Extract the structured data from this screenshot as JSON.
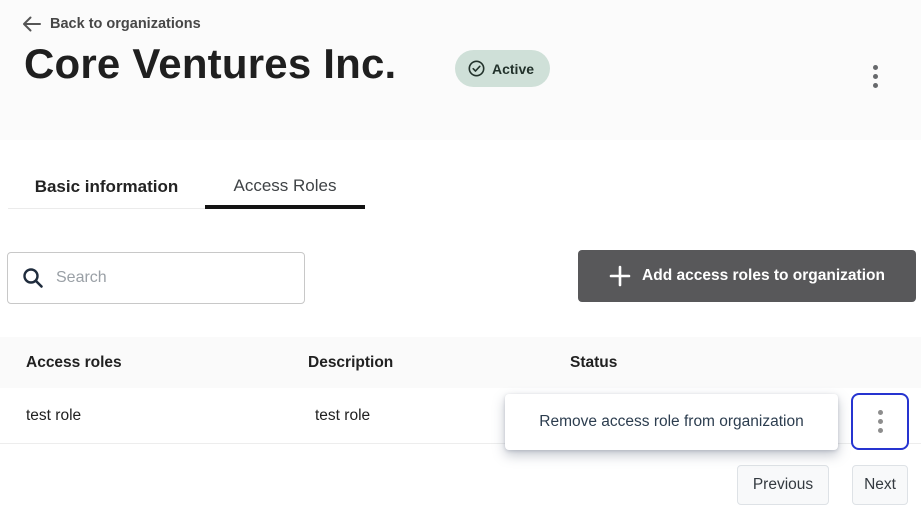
{
  "header": {
    "back_label": "Back to organizations",
    "title": "Core Ventures Inc.",
    "status_badge": "Active",
    "icons": {
      "back": "left-arrow-icon",
      "status": "check-circle-icon",
      "menu": "vertical-ellipsis-icon"
    }
  },
  "tabs": [
    {
      "label": "Basic information",
      "active": false
    },
    {
      "label": "Access Roles",
      "active": true
    }
  ],
  "toolbar": {
    "search_placeholder": "Search",
    "search_value": "",
    "search_icon": "magnifier-icon",
    "add_button_label": "Add access roles to organization",
    "add_button_icon": "plus-icon"
  },
  "table": {
    "columns": [
      "Access roles",
      "Description",
      "Status"
    ],
    "rows": [
      {
        "access_role": "test role",
        "description": "test role",
        "status": ""
      }
    ],
    "row_menu_icon": "vertical-ellipsis-icon"
  },
  "tooltip": {
    "label": "Remove access role from organization"
  },
  "pagination": {
    "previous_label": "Previous",
    "next_label": "Next"
  },
  "colors": {
    "accent_blue_focus": "#2634d0",
    "badge_green": "#cfe0d8",
    "badge_text": "#22322b",
    "add_button_dark": "#58585a",
    "tab_indicator": "#131313",
    "header_band": "#fbfbfb",
    "table_header_bg": "#fafafa"
  }
}
